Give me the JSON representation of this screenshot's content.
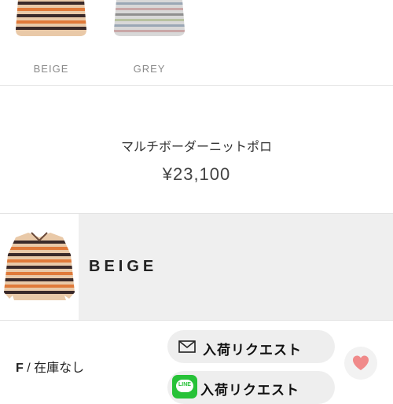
{
  "swatches": [
    {
      "label": "BEIGE",
      "icon": "striped-sweater-beige-image"
    },
    {
      "label": "GREY",
      "icon": "striped-sweater-grey-image"
    }
  ],
  "product": {
    "name": "マルチボーダーニットポロ",
    "price": "¥23,100"
  },
  "color_row": {
    "name": "BEIGE",
    "icon": "striped-polo-beige-image"
  },
  "stock": {
    "size": "F",
    "separator": " / ",
    "status": "在庫なし"
  },
  "buttons": {
    "mail_request": "入荷リクエスト",
    "line_request": "入荷リクエスト",
    "line_logo": "LINE"
  },
  "icons": {
    "mail": "mail-icon",
    "line": "line-icon",
    "favorite": "heart-icon"
  },
  "colors": {
    "heart": "#f08a8a",
    "line_green": "#27c238",
    "stripe_dark": "#3a2a2a",
    "stripe_orange": "#e07a3a",
    "stripe_beige": "#e9c9a8"
  }
}
